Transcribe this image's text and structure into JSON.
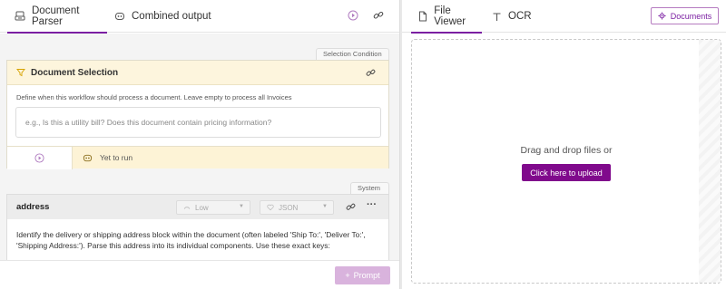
{
  "left_tabs": [
    {
      "label": "Document Parser",
      "icon": "document-parser-icon",
      "active": true
    },
    {
      "label": "Combined output",
      "icon": "combined-output-icon",
      "active": false
    }
  ],
  "selection": {
    "chip": "Selection Condition",
    "title": "Document Selection",
    "description": "Define when this workflow should process a document. Leave empty to process all Invoices",
    "placeholder": "e.g., Is this a utility bill? Does this document contain pricing information?",
    "status": "Yet to run"
  },
  "field": {
    "chip": "System",
    "name": "address",
    "effort": "Low",
    "format": "JSON",
    "more": "···",
    "prompt_text": "Identify the delivery or shipping address block within the document (often labeled 'Ship To:', 'Deliver To:', 'Shipping Address:'). Parse this address into its individual components. Use these exact keys:"
  },
  "footer": {
    "prompt_label": "Prompt"
  },
  "right_tabs": [
    {
      "label": "File Viewer",
      "icon": "file-icon",
      "active": true
    },
    {
      "label": "OCR",
      "icon": "text-icon",
      "active": false
    }
  ],
  "documents_button": "Documents",
  "dropzone": {
    "text": "Drag and drop files or",
    "button": "Click here to upload"
  },
  "colors": {
    "accent": "#7b1fa2",
    "upload_bg": "#800a8c",
    "warning_bg": "#fdf5dd",
    "disabled_prompt": "#d9b3dd"
  }
}
